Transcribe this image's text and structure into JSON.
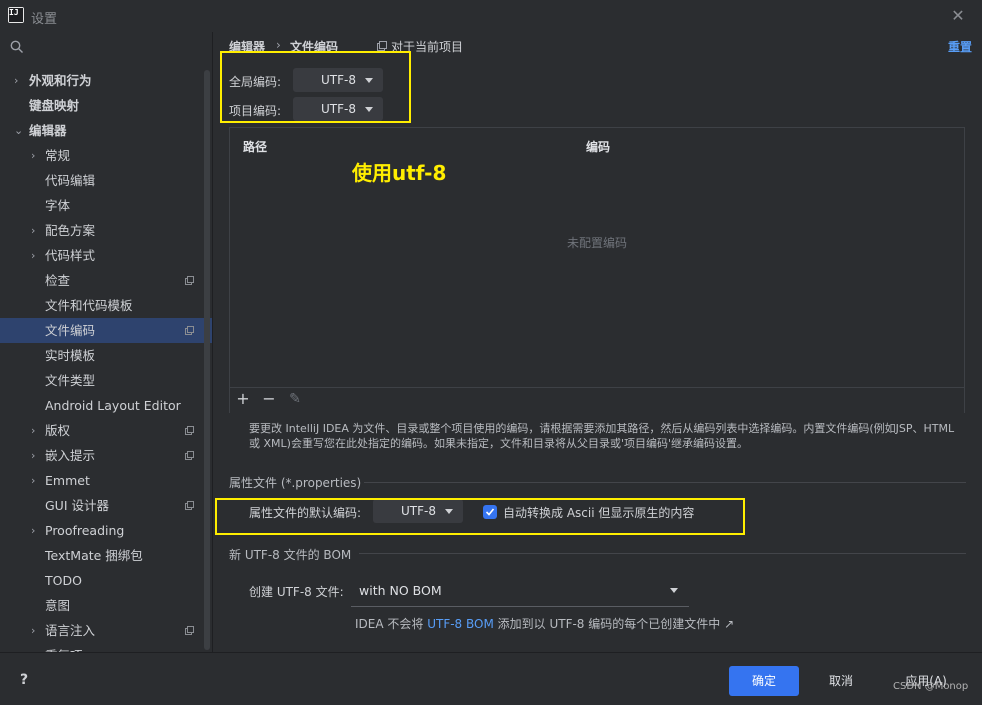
{
  "window": {
    "title": "设置",
    "icon_text": "IJ"
  },
  "sidebar": {
    "items": [
      {
        "label": "外观和行为",
        "chevron": "›",
        "bold": true,
        "selected": false,
        "copy_icon": false
      },
      {
        "label": "键盘映射",
        "chevron": "",
        "bold": true,
        "selected": false,
        "copy_icon": false
      },
      {
        "label": "编辑器",
        "chevron": "⌄",
        "bold": true,
        "selected": false,
        "copy_icon": false
      },
      {
        "label": "常规",
        "chevron": "›",
        "bold": false,
        "selected": false,
        "copy_icon": false
      },
      {
        "label": "代码编辑",
        "chevron": "",
        "bold": false,
        "selected": false,
        "copy_icon": false
      },
      {
        "label": "字体",
        "chevron": "",
        "bold": false,
        "selected": false,
        "copy_icon": false
      },
      {
        "label": "配色方案",
        "chevron": "›",
        "bold": false,
        "selected": false,
        "copy_icon": false
      },
      {
        "label": "代码样式",
        "chevron": "›",
        "bold": false,
        "selected": false,
        "copy_icon": false
      },
      {
        "label": "检查",
        "chevron": "",
        "bold": false,
        "selected": false,
        "copy_icon": true
      },
      {
        "label": "文件和代码模板",
        "chevron": "",
        "bold": false,
        "selected": false,
        "copy_icon": false
      },
      {
        "label": "文件编码",
        "chevron": "",
        "bold": false,
        "selected": true,
        "copy_icon": true
      },
      {
        "label": "实时模板",
        "chevron": "",
        "bold": false,
        "selected": false,
        "copy_icon": false
      },
      {
        "label": "文件类型",
        "chevron": "",
        "bold": false,
        "selected": false,
        "copy_icon": false
      },
      {
        "label": "Android Layout Editor",
        "chevron": "",
        "bold": false,
        "selected": false,
        "copy_icon": false
      },
      {
        "label": "版权",
        "chevron": "›",
        "bold": false,
        "selected": false,
        "copy_icon": true
      },
      {
        "label": "嵌入提示",
        "chevron": "›",
        "bold": false,
        "selected": false,
        "copy_icon": true
      },
      {
        "label": "Emmet",
        "chevron": "›",
        "bold": false,
        "selected": false,
        "copy_icon": false
      },
      {
        "label": "GUI 设计器",
        "chevron": "",
        "bold": false,
        "selected": false,
        "copy_icon": true
      },
      {
        "label": "Proofreading",
        "chevron": "›",
        "bold": false,
        "selected": false,
        "copy_icon": false
      },
      {
        "label": "TextMate 捆绑包",
        "chevron": "",
        "bold": false,
        "selected": false,
        "copy_icon": false
      },
      {
        "label": "TODO",
        "chevron": "",
        "bold": false,
        "selected": false,
        "copy_icon": false
      },
      {
        "label": "意图",
        "chevron": "",
        "bold": false,
        "selected": false,
        "copy_icon": false
      },
      {
        "label": "语言注入",
        "chevron": "›",
        "bold": false,
        "selected": false,
        "copy_icon": true
      },
      {
        "label": "重复项",
        "chevron": "",
        "bold": false,
        "selected": false,
        "copy_icon": false
      }
    ]
  },
  "breadcrumb": {
    "part1": "编辑器",
    "separator": "›",
    "part2": "文件编码",
    "scope": "对于当前项目"
  },
  "reset_label": "重置",
  "global_encoding": {
    "label": "全局编码:",
    "value": "UTF-8"
  },
  "project_encoding": {
    "label": "项目编码:",
    "value": "UTF-8"
  },
  "table": {
    "col_path": "路径",
    "col_encoding": "编码",
    "empty_text": "未配置编码"
  },
  "annotation": "使用utf-8",
  "toolbar": {
    "add": "+",
    "remove": "−",
    "edit": "✎"
  },
  "help_text": "要更改 IntelliJ IDEA 为文件、目录或整个项目使用的编码，请根据需要添加其路径，然后从编码列表中选择编码。内置文件编码(例如JSP、HTML 或 XML)会重写您在此处指定的编码。如果未指定，文件和目录将从父目录或'项目编码'继承编码设置。",
  "properties": {
    "section_title": "属性文件 (*.properties)",
    "default_label": "属性文件的默认编码:",
    "default_value": "UTF-8",
    "native_to_ascii_label": "自动转换成 Ascii 但显示原生的内容",
    "native_to_ascii_checked": true
  },
  "bom": {
    "section_title": "新 UTF-8 文件的 BOM",
    "create_label": "创建 UTF-8 文件:",
    "create_value": "with NO BOM",
    "note_prefix": "IDEA 不会将 ",
    "note_link": "UTF-8 BOM",
    "note_suffix": " 添加到以 UTF-8 编码的每个已创建文件中 ↗"
  },
  "footer": {
    "help": "?",
    "ok": "确定",
    "cancel": "取消",
    "apply": "应用(A)"
  },
  "watermark": "CSDN @Monop",
  "colors": {
    "accent": "#3574f0",
    "highlight": "#ffee00",
    "link": "#589df6",
    "selection": "#2e436e"
  }
}
